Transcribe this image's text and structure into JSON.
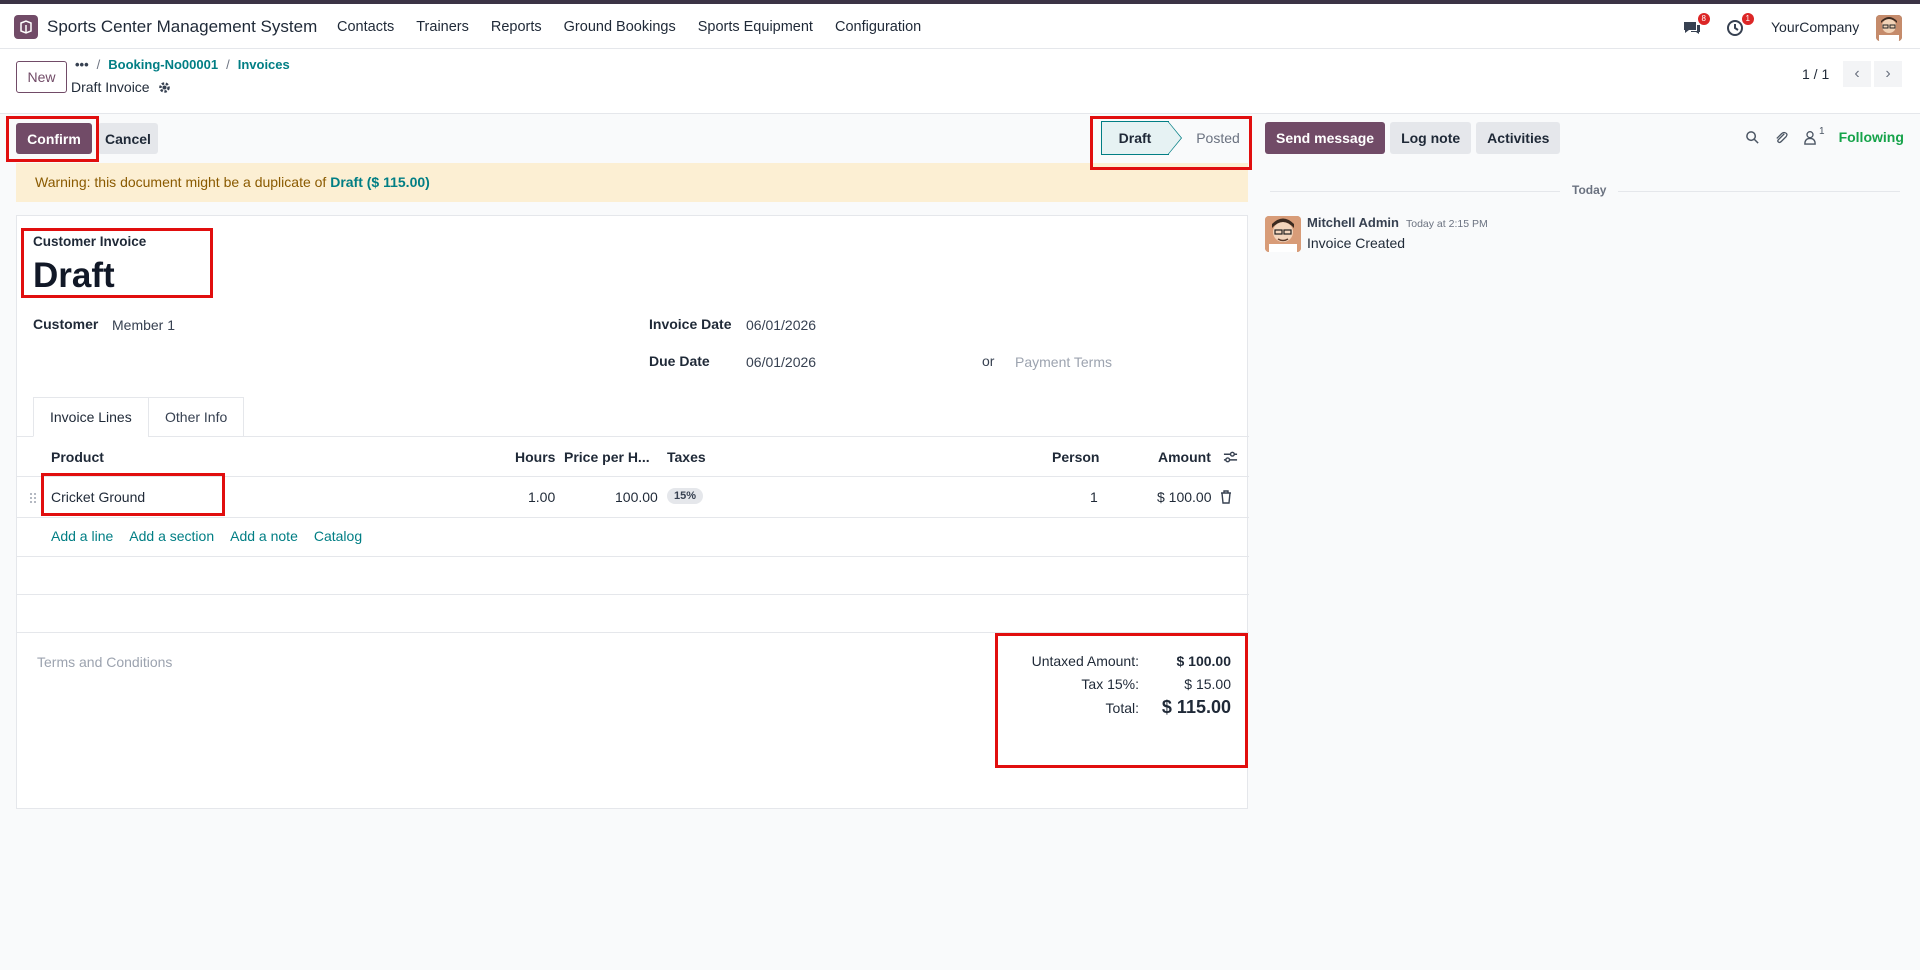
{
  "app": {
    "name": "Sports Center Management System"
  },
  "menu": [
    "Contacts",
    "Trainers",
    "Reports",
    "Ground Bookings",
    "Sports Equipment",
    "Configuration"
  ],
  "systray": {
    "messages_count": "8",
    "activities_count": "1",
    "company": "YourCompany"
  },
  "controls": {
    "new_label": "New",
    "breadcrumb": [
      "Booking-No00001",
      "Invoices"
    ],
    "record_title": "Draft Invoice",
    "pager": "1 / 1"
  },
  "status": {
    "confirm_label": "Confirm",
    "cancel_label": "Cancel",
    "stages": [
      "Draft",
      "Posted"
    ],
    "current_stage": "Draft"
  },
  "warning": {
    "text": "Warning: this document might be a duplicate of",
    "link": "Draft ($ 115.00)"
  },
  "invoice": {
    "type": "Customer Invoice",
    "name": "Draft",
    "customer_label": "Customer",
    "customer": "Member 1",
    "invoice_date_label": "Invoice Date",
    "invoice_date": "06/01/2026",
    "due_date_label": "Due Date",
    "due_date": "06/01/2026",
    "or_label": "or",
    "payment_terms_placeholder": "Payment Terms"
  },
  "tabs": [
    "Invoice Lines",
    "Other Info"
  ],
  "lines": {
    "headers": {
      "product": "Product",
      "hours": "Hours",
      "price": "Price per H...",
      "taxes": "Taxes",
      "person": "Person",
      "amount": "Amount"
    },
    "rows": [
      {
        "product": "Cricket Ground",
        "hours": "1.00",
        "price": "100.00",
        "tax": "15%",
        "person": "1",
        "amount": "$ 100.00"
      }
    ],
    "actions": [
      "Add a line",
      "Add a section",
      "Add a note",
      "Catalog"
    ]
  },
  "terms_placeholder": "Terms and Conditions",
  "totals": {
    "untaxed_label": "Untaxed Amount:",
    "untaxed": "$ 100.00",
    "tax_label": "Tax 15%:",
    "tax": "$ 15.00",
    "total_label": "Total:",
    "total": "$ 115.00"
  },
  "chatter": {
    "send_message": "Send message",
    "log_note": "Log note",
    "activities": "Activities",
    "followers_count": "1",
    "following": "Following",
    "day": "Today",
    "message": {
      "author": "Mitchell Admin",
      "time": "Today at 2:15 PM",
      "body": "Invoice Created"
    }
  },
  "colors": {
    "brand": "#714b67",
    "link": "#017e84",
    "highlight": "#e10e0e",
    "warning_bg": "#fcefd3"
  }
}
